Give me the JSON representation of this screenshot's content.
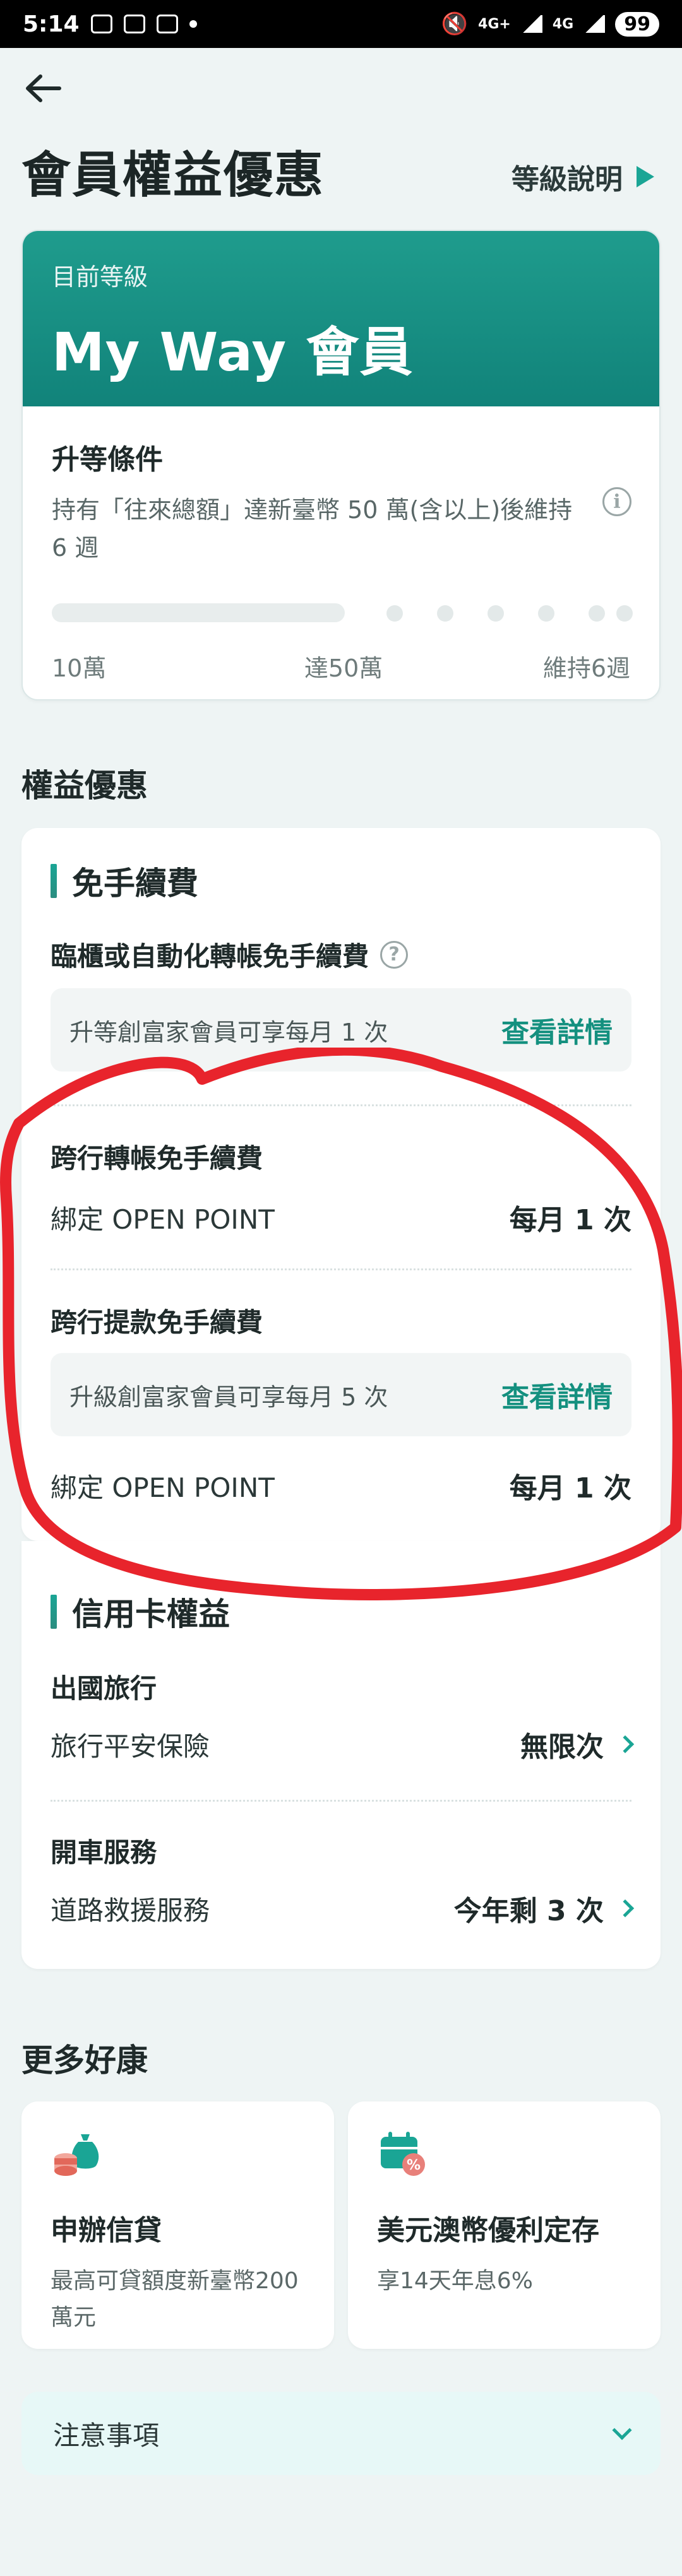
{
  "status_bar": {
    "time": "5:14",
    "network": "4G+",
    "network2": "4G",
    "battery": "99"
  },
  "header": {
    "title": "會員權益優惠",
    "level_link": "等級說明"
  },
  "member_card": {
    "current_label": "目前等級",
    "level_name": "My Way 會員",
    "upgrade_title": "升等條件",
    "upgrade_desc": "持有「往來總額」達新臺幣 50 萬(含以上)後維持 6 週",
    "progress_labels": [
      "10萬",
      "達50萬",
      "維持6週"
    ],
    "progress_fraction": 0.5
  },
  "benefits": {
    "section_title": "權益優惠",
    "fee_free": {
      "title": "免手續費",
      "item1_title": "臨櫃或自動化轉帳免手續費",
      "item1_note": "升等創富家會員可享每月 1 次",
      "item1_link": "查看詳情",
      "item2_title": "跨行轉帳免手續費",
      "item2_label": "綁定 OPEN POINT",
      "item2_value": "每月 1 次",
      "item3_title": "跨行提款免手續費",
      "item3_note": "升級創富家會員可享每月 5 次",
      "item3_link": "查看詳情",
      "item3_label": "綁定 OPEN POINT",
      "item3_value": "每月 1 次"
    },
    "credit_card": {
      "title": "信用卡權益",
      "travel_title": "出國旅行",
      "travel_label": "旅行平安保險",
      "travel_value": "無限次",
      "car_title": "開車服務",
      "car_label": "道路救援服務",
      "car_value": "今年剩 3 次"
    }
  },
  "more": {
    "section_title": "更多好康",
    "promo1_title": "申辦信貸",
    "promo1_desc": "最高可貸額度新臺幣200 萬元",
    "promo2_title": "美元澳幣優利定存",
    "promo2_desc": "享14天年息6%"
  },
  "notice": {
    "label": "注意事項"
  },
  "colors": {
    "accent": "#1aa595",
    "header_gradient_top": "#1f9c8d",
    "annotation": "#e8242c"
  }
}
